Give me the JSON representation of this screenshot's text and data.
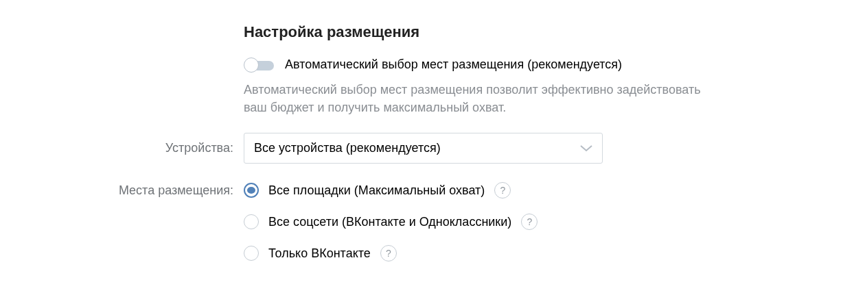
{
  "section_title": "Настройка размещения",
  "auto_toggle": {
    "label": "Автоматический выбор мест размещения (рекомендуется)",
    "on": false
  },
  "auto_description": "Автоматический выбор мест размещения позволит эффективно задействовать ваш бюджет и получить максимальный охват.",
  "devices": {
    "label": "Устройства:",
    "value": "Все устройства (рекомендуется)"
  },
  "placements": {
    "label": "Места размещения:",
    "options": [
      {
        "label": "Все площадки (Максимальный охват)",
        "help": "?",
        "selected": true
      },
      {
        "label": "Все соцсети (ВКонтакте и Одноклассники)",
        "help": "?",
        "selected": false
      },
      {
        "label": "Только ВКонтакте",
        "help": "?",
        "selected": false
      }
    ]
  }
}
